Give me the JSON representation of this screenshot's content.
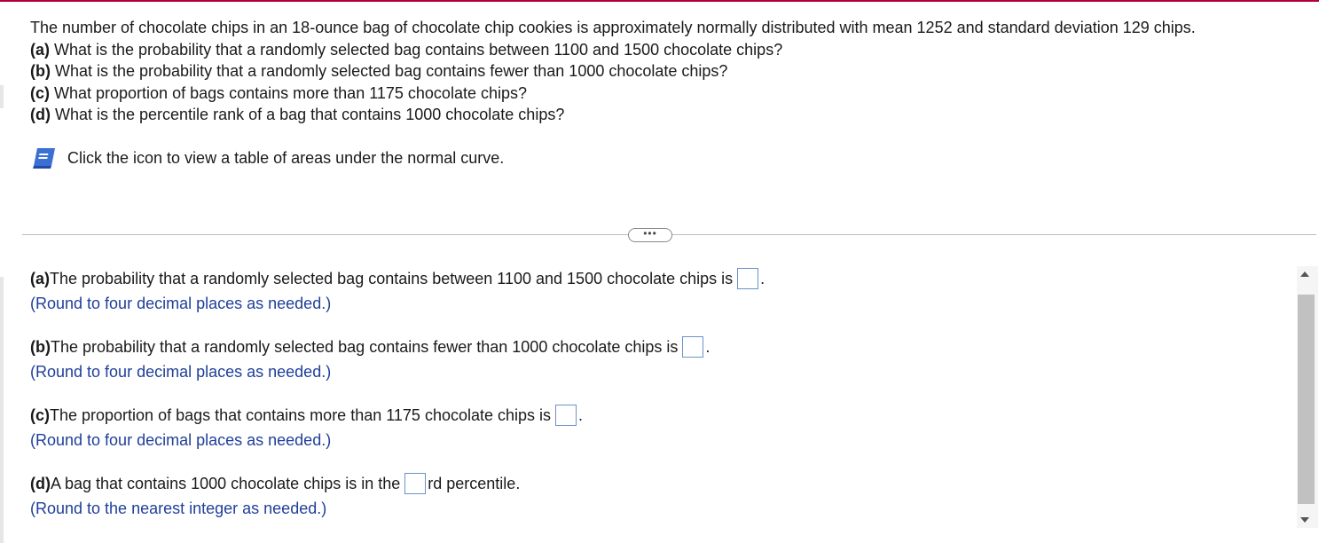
{
  "question": {
    "stem": "The number of chocolate chips in an 18-ounce bag of chocolate chip cookies is approximately normally distributed with mean 1252 and standard deviation 129 chips.",
    "parts": [
      {
        "label": "(a)",
        "text": " What is the probability that a randomly selected bag contains between 1100 and 1500 chocolate chips?"
      },
      {
        "label": "(b)",
        "text": " What is the probability that a randomly selected bag contains fewer than 1000 chocolate chips?"
      },
      {
        "label": "(c)",
        "text": " What proportion of bags contains more than 1175 chocolate chips?"
      },
      {
        "label": "(d)",
        "text": " What is the percentile rank of a bag that contains 1000 chocolate chips?"
      }
    ]
  },
  "hint": {
    "text": "Click the icon to view a table of areas under the normal curve.",
    "icon": "book-icon"
  },
  "more_button": "•••",
  "answers": [
    {
      "label": "(a)",
      "text": " The probability that a randomly selected bag contains between 1100 and 1500 chocolate chips is",
      "after": ".",
      "value": "",
      "note": "(Round to four decimal places as needed.)"
    },
    {
      "label": "(b)",
      "text": " The probability that a randomly selected bag contains fewer than 1000 chocolate chips is",
      "after": ".",
      "value": "",
      "note": "(Round to four decimal places as needed.)"
    },
    {
      "label": "(c)",
      "text": " The proportion of bags that contains more than 1175 chocolate chips is",
      "after": ".",
      "value": "",
      "note": "(Round to four decimal places as needed.)"
    },
    {
      "label": "(d)",
      "text": " A bag that contains 1000 chocolate chips is in the",
      "after": "rd percentile.",
      "value": "",
      "note": "(Round to the nearest integer as needed.)"
    }
  ],
  "colors": {
    "accent_border": "#b0003a",
    "note_text": "#1f3f9a",
    "input_border": "#6d90c8"
  }
}
